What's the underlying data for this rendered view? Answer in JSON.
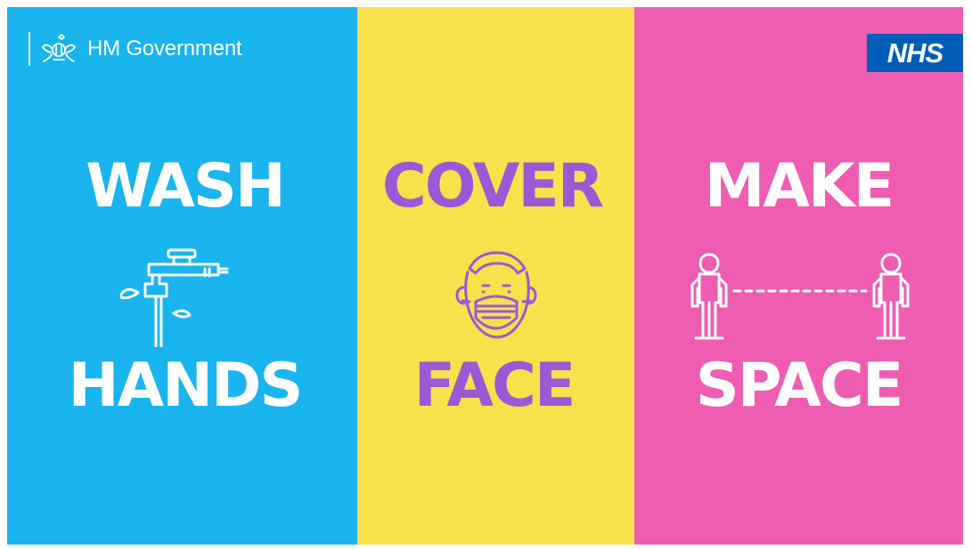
{
  "colors": {
    "wash_panel": "#1ab5ef",
    "cover_panel": "#f8e14b",
    "make_panel": "#ef5db2",
    "wash_text": "#ffffff",
    "cover_text": "#9b59d6",
    "make_text": "#ffffff",
    "nhs_blue": "#005eb8"
  },
  "branding": {
    "government_name": "HM Government",
    "government_icon": "royal-crest-icon",
    "nhs_label": "NHS"
  },
  "panels": [
    {
      "key": "wash",
      "top_word": "WASH",
      "bottom_word": "HANDS",
      "icon_name": "tap-icon"
    },
    {
      "key": "cover",
      "top_word": "COVER",
      "bottom_word": "FACE",
      "icon_name": "face-mask-icon"
    },
    {
      "key": "make",
      "top_word": "MAKE",
      "bottom_word": "SPACE",
      "icon_name": "social-distance-icon"
    }
  ]
}
